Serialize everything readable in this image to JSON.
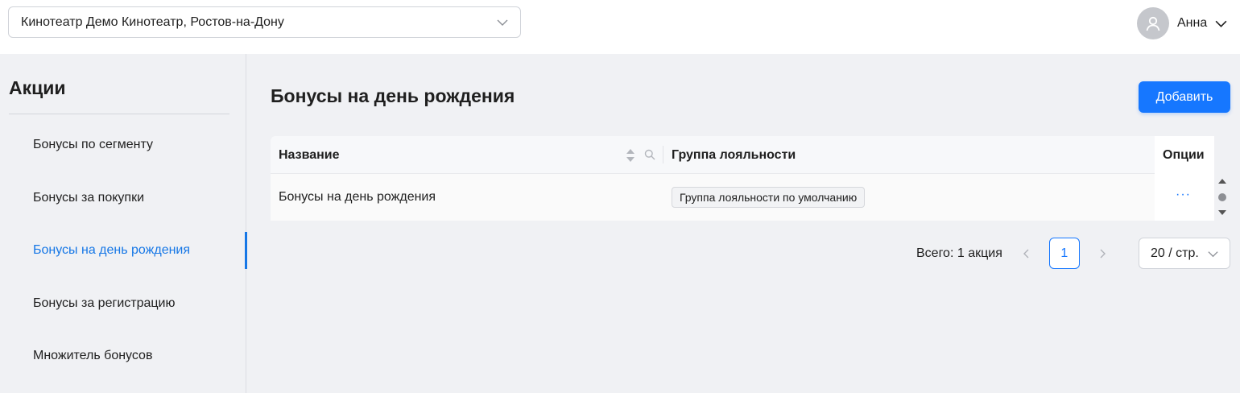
{
  "header": {
    "cinema_select_value": "Кинотеатр Демо Кинотеатр, Ростов-на-Дону",
    "user_name": "Анна",
    "icons": [
      "chevron-down-icon",
      "user-avatar-icon"
    ]
  },
  "sidebar": {
    "title": "Акции",
    "items": [
      {
        "label": "Бонусы по сегменту",
        "active": false
      },
      {
        "label": "Бонусы за покупки",
        "active": false
      },
      {
        "label": "Бонусы на день рождения",
        "active": true
      },
      {
        "label": "Бонусы за регистрацию",
        "active": false
      },
      {
        "label": "Множитель бонусов",
        "active": false
      }
    ]
  },
  "main": {
    "title": "Бонусы на день рождения",
    "add_label": "Добавить",
    "table": {
      "columns": [
        "Название",
        "Группа лояльности",
        "Опции"
      ],
      "rows": [
        {
          "name": "Бонусы на день рождения",
          "group": "Группа лояльности по умолчанию",
          "options": "···"
        }
      ]
    },
    "pagination": {
      "total": "Всего: 1 акция",
      "current_page": "1",
      "page_size": "20 / стр."
    }
  },
  "colors": {
    "accent": "#1677ff",
    "active_nav": "#1677e6",
    "background": "#f0f1f4"
  }
}
